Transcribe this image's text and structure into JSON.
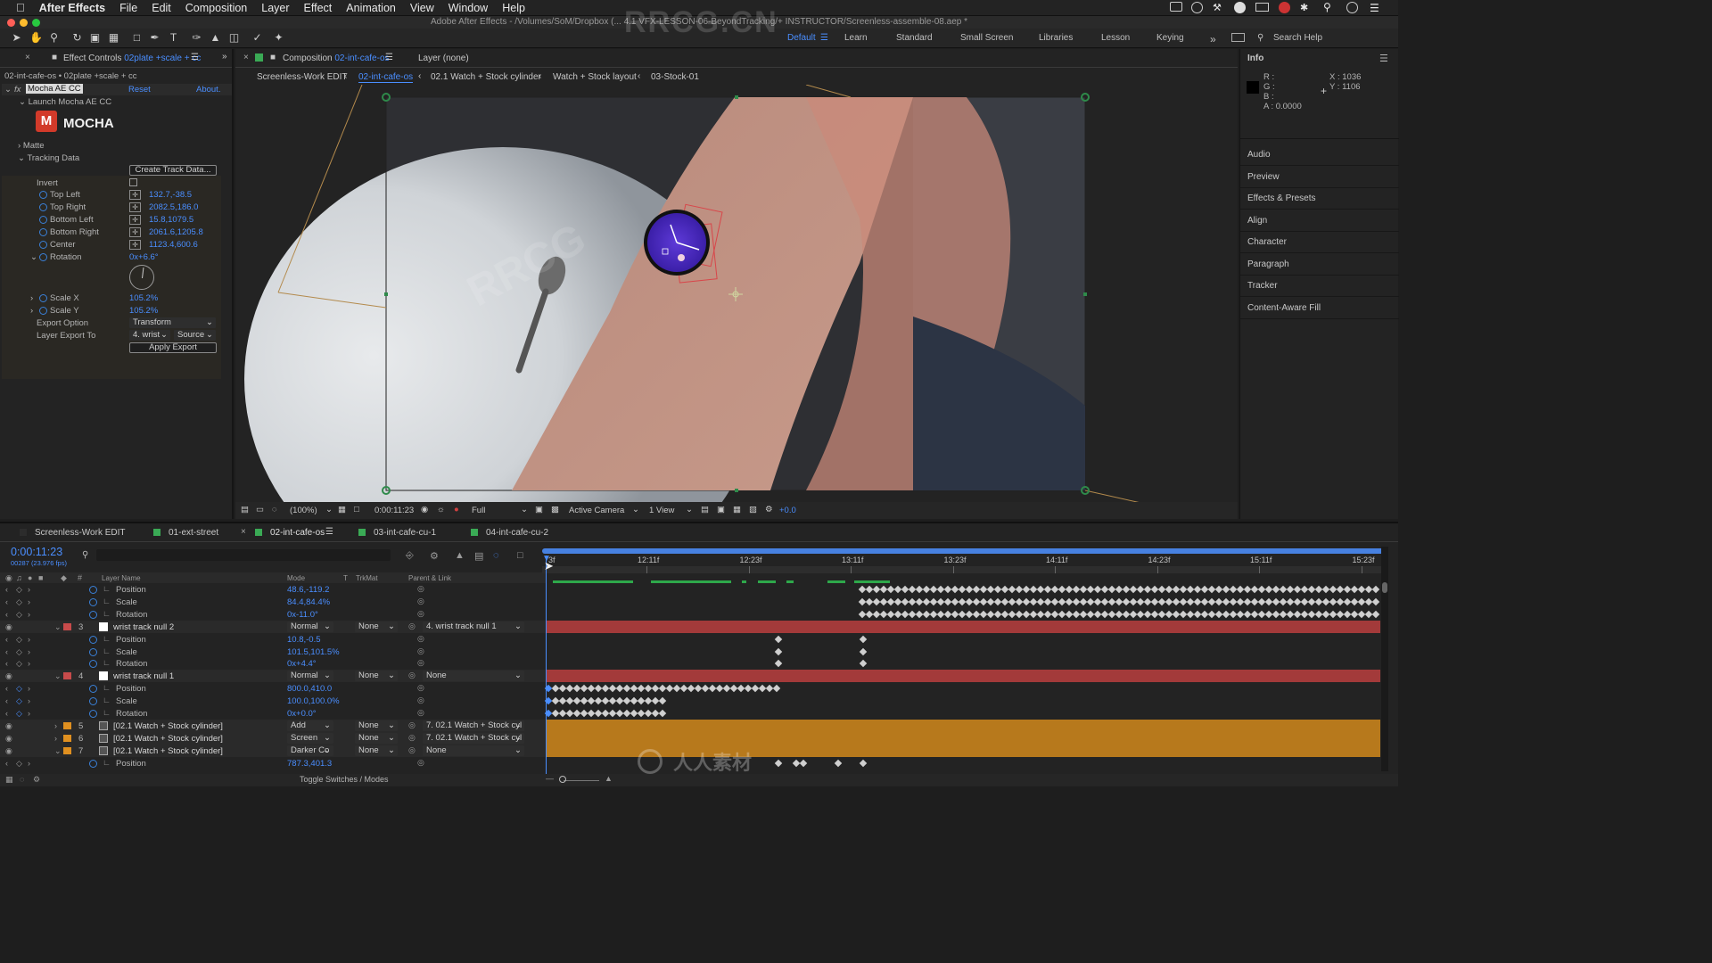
{
  "menubar": {
    "app": "After Effects",
    "items": [
      "File",
      "Edit",
      "Composition",
      "Layer",
      "Effect",
      "Animation",
      "View",
      "Window",
      "Help"
    ]
  },
  "titlebar": {
    "title": "Adobe After Effects - /Volumes/SoM/Dropbox (... 4.1 VFX-LESSON-06-BeyondTracking/+ INSTRUCTOR/Screenless-assemble-08.aep *"
  },
  "toolbar": {
    "workspaces": [
      "Default",
      "Learn",
      "Standard",
      "Small Screen",
      "Libraries",
      "Lesson",
      "Keying"
    ],
    "search_placeholder": "Search Help"
  },
  "effect_controls": {
    "tab_title": "Effect Controls",
    "tab_layer": "02plate +scale + cc",
    "breadcrumb": "02-int-cafe-os • 02plate +scale + cc",
    "effect_name": "Mocha AE CC",
    "reset": "Reset",
    "about": "About.",
    "launch": "Launch Mocha AE CC",
    "logo": "MOCHA",
    "matte": "Matte",
    "tracking_data": "Tracking Data",
    "create_track": "Create Track Data...",
    "invert": "Invert",
    "props": [
      {
        "name": "Top Left",
        "value": "132.7,-38.5"
      },
      {
        "name": "Top Right",
        "value": "2082.5,186.0"
      },
      {
        "name": "Bottom Left",
        "value": "15.8,1079.5"
      },
      {
        "name": "Bottom Right",
        "value": "2061.6,1205.8"
      },
      {
        "name": "Center",
        "value": "1123.4,600.6"
      }
    ],
    "rotation_label": "Rotation",
    "rotation_value": "0x+6.6°",
    "scale_x_label": "Scale X",
    "scale_x_value": "105.2%",
    "scale_y_label": "Scale Y",
    "scale_y_value": "105.2%",
    "export_option_label": "Export Option",
    "export_option_value": "Transform",
    "layer_export_label": "Layer Export To",
    "layer_export_value": "4. wrist",
    "source_value": "Source",
    "apply_export": "Apply Export"
  },
  "composition": {
    "tab_title": "Composition",
    "tab_comp": "02-int-cafe-os",
    "layer_tab": "Layer (none)",
    "breadcrumbs": [
      "Screenless-Work EDIT",
      "02-int-cafe-os",
      "02.1 Watch + Stock cylinder",
      "Watch + Stock layout",
      "03-Stock-01"
    ],
    "zoom": "(100%)",
    "timecode": "0:00:11:23",
    "resolution": "Full",
    "camera": "Active Camera",
    "views": "1 View",
    "exposure": "+0.0"
  },
  "right_panel": {
    "info_title": "Info",
    "r": "R :",
    "g": "G :",
    "b": "B :",
    "a": "A : 0.0000",
    "x": "X : 1036",
    "y": "Y : 1106",
    "panels": [
      "Audio",
      "Preview",
      "Effects & Presets",
      "Align",
      "Character",
      "Paragraph",
      "Tracker",
      "Content-Aware Fill"
    ]
  },
  "timeline": {
    "tabs": [
      {
        "label": "Screenless-Work EDIT",
        "color": "#2c2c2c"
      },
      {
        "label": "01-ext-street",
        "color": "#3aaa55"
      },
      {
        "label": "02-int-cafe-os",
        "color": "#3aaa55"
      },
      {
        "label": "03-int-cafe-cu-1",
        "color": "#3aaa55"
      },
      {
        "label": "04-int-cafe-cu-2",
        "color": "#3aaa55"
      }
    ],
    "timecode": "0:00:11:23",
    "frame_info": "00287 (23.976 fps)",
    "col_layer_name": "Layer Name",
    "col_mode": "Mode",
    "col_t": "T",
    "col_trkmat": "TrkMat",
    "col_parent": "Parent & Link",
    "ruler": [
      "12:11f",
      "12:23f",
      "13:11f",
      "13:23f",
      "14:11f",
      "14:23f",
      "15:11f",
      "15:23f"
    ],
    "ruler_start": "3f",
    "rows": [
      {
        "type": "prop",
        "name": "Position",
        "value": "48.6,-119.2"
      },
      {
        "type": "prop",
        "name": "Scale",
        "value": "84.4,84.4%"
      },
      {
        "type": "prop",
        "name": "Rotation",
        "value": "0x-11.0°"
      },
      {
        "type": "layer",
        "num": "3",
        "name": "wrist track null 2",
        "mode": "Normal",
        "trkmat": "None",
        "parent": "4. wrist track null 1",
        "label": "#c84b4b"
      },
      {
        "type": "prop",
        "name": "Position",
        "value": "10.8,-0.5"
      },
      {
        "type": "prop",
        "name": "Scale",
        "value": "101.5,101.5%"
      },
      {
        "type": "prop",
        "name": "Rotation",
        "value": "0x+4.4°"
      },
      {
        "type": "layer",
        "num": "4",
        "name": "wrist track null 1",
        "mode": "Normal",
        "trkmat": "None",
        "parent": "None",
        "label": "#c84b4b"
      },
      {
        "type": "prop",
        "name": "Position",
        "value": "800.0,410.0"
      },
      {
        "type": "prop",
        "name": "Scale",
        "value": "100.0,100.0%"
      },
      {
        "type": "prop",
        "name": "Rotation",
        "value": "0x+0.0°"
      },
      {
        "type": "layer",
        "num": "5",
        "name": "[02.1 Watch + Stock cylinder]",
        "mode": "Add",
        "trkmat": "None",
        "parent": "7. 02.1 Watch + Stock cyl",
        "label": "#e09020"
      },
      {
        "type": "layer",
        "num": "6",
        "name": "[02.1 Watch + Stock cylinder]",
        "mode": "Screen",
        "trkmat": "None",
        "parent": "7. 02.1 Watch + Stock cyl",
        "label": "#e09020"
      },
      {
        "type": "layer",
        "num": "7",
        "name": "[02.1 Watch + Stock cylinder]",
        "mode": "Darker Co",
        "trkmat": "None",
        "parent": "None",
        "label": "#e09020"
      },
      {
        "type": "prop",
        "name": "Position",
        "value": "787.3,401.3"
      }
    ],
    "toggle_label": "Toggle Switches / Modes"
  },
  "watermarks": {
    "text1": "RRCG.CN",
    "text2": "RRCG",
    "text3": "人人素材"
  }
}
